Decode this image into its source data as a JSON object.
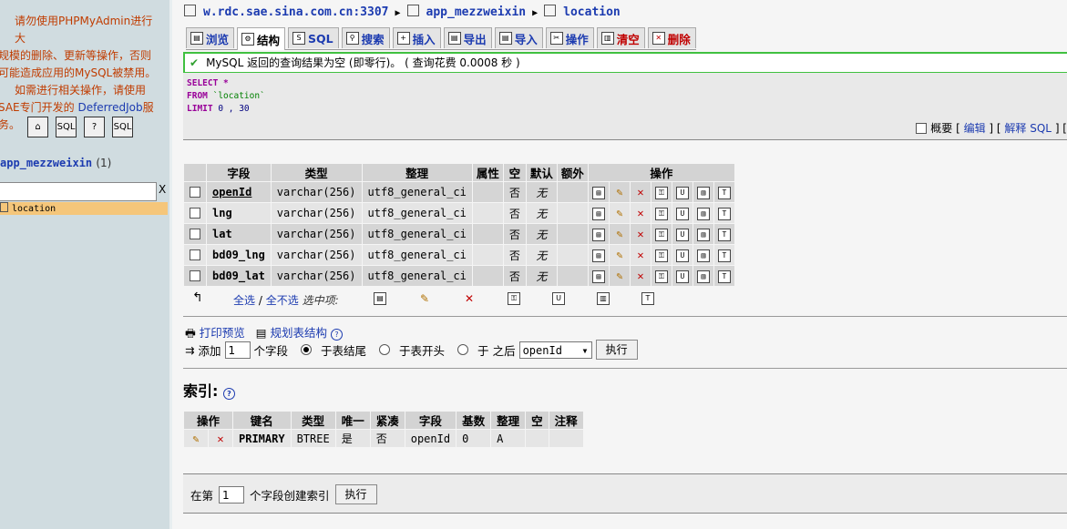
{
  "nav": {
    "warning_line1": "请勿使用PHPMyAdmin进行大",
    "warning_line2": "规模的删除、更新等操作，否则",
    "warning_line3": "可能造成应用的MySQL被禁用。",
    "warning_line4": "如需进行相关操作，请使用",
    "warning_line5_prefix": "SAE专门开发的 ",
    "warning_link": "DeferredJob",
    "warning_line5_suffix": "服",
    "warning_line6": "务。",
    "icons": [
      "home-icon",
      "sql-icon",
      "query-icon",
      "docs-icon"
    ],
    "db_name": "app_mezzweixin",
    "db_count": "(1)",
    "filter_value": "",
    "filter_clear": "X",
    "table_item": "location"
  },
  "breadcrumb": {
    "server": "w.rdc.sae.sina.com.cn:3307",
    "database": "app_mezzweixin",
    "table": "location"
  },
  "tabs": [
    {
      "label": "浏览",
      "icon": "browse-icon"
    },
    {
      "label": "结构",
      "icon": "structure-icon"
    },
    {
      "label": "SQL",
      "icon": "sql-icon"
    },
    {
      "label": "搜索",
      "icon": "search-icon"
    },
    {
      "label": "插入",
      "icon": "insert-icon"
    },
    {
      "label": "导出",
      "icon": "export-icon"
    },
    {
      "label": "导入",
      "icon": "import-icon"
    },
    {
      "label": "操作",
      "icon": "operations-icon"
    },
    {
      "label": "清空",
      "icon": "empty-icon"
    },
    {
      "label": "删除",
      "icon": "drop-icon"
    }
  ],
  "notice": "MySQL 返回的查询结果为空 (即零行)。 ( 查询花费 0.0008 秒 )",
  "sql": {
    "select_kw": "SELECT",
    "select_arg": " *",
    "from_kw": "FROM",
    "from_arg": " `location`",
    "limit_kw": "LIMIT",
    "limit_arg": " 0 , 30"
  },
  "sql_links": {
    "profile": "概要",
    "edit": "编辑",
    "explain": "解释 SQL"
  },
  "structure": {
    "headers": [
      "字段",
      "类型",
      "整理",
      "属性",
      "空",
      "默认",
      "额外",
      "操作"
    ],
    "rows": [
      {
        "field": "openId",
        "type": "varchar(256)",
        "collation": "utf8_general_ci",
        "attributes": "",
        "null": "否",
        "default": "无",
        "extra": ""
      },
      {
        "field": "lng",
        "type": "varchar(256)",
        "collation": "utf8_general_ci",
        "attributes": "",
        "null": "否",
        "default": "无",
        "extra": ""
      },
      {
        "field": "lat",
        "type": "varchar(256)",
        "collation": "utf8_general_ci",
        "attributes": "",
        "null": "否",
        "default": "无",
        "extra": ""
      },
      {
        "field": "bd09_lng",
        "type": "varchar(256)",
        "collation": "utf8_general_ci",
        "attributes": "",
        "null": "否",
        "default": "无",
        "extra": ""
      },
      {
        "field": "bd09_lat",
        "type": "varchar(256)",
        "collation": "utf8_general_ci",
        "attributes": "",
        "null": "否",
        "default": "无",
        "extra": ""
      }
    ]
  },
  "selection": {
    "check_all": "全选",
    "separator": "/",
    "uncheck_all": "全不选",
    "with_selected": "选中项:"
  },
  "print": {
    "print_view": "打印预览",
    "propose": "规划表结构"
  },
  "add_field": {
    "label": "添加",
    "count": "1",
    "unit": "个字段",
    "opt_end": "于表结尾",
    "opt_begin": "于表开头",
    "opt_after_prefix": "于",
    "opt_after": "之后",
    "after_field": "openId",
    "go": "执行"
  },
  "indexes": {
    "title": "索引:",
    "headers": [
      "操作",
      "键名",
      "类型",
      "唯一",
      "紧凑",
      "字段",
      "基数",
      "整理",
      "空",
      "注释"
    ],
    "row": {
      "keyname": "PRIMARY",
      "type": "BTREE",
      "unique": "是",
      "packed": "否",
      "column": "openId",
      "cardinality": "0",
      "collation": "A",
      "null": "",
      "comment": ""
    }
  },
  "create_index": {
    "prefix": "在第",
    "count": "1",
    "suffix": "个字段创建索引",
    "go": "执行"
  },
  "colors": {
    "link": "#1c3bb0",
    "warning": "#c03c00",
    "success_border": "#40c040",
    "nav_bg": "#d0dce0"
  }
}
